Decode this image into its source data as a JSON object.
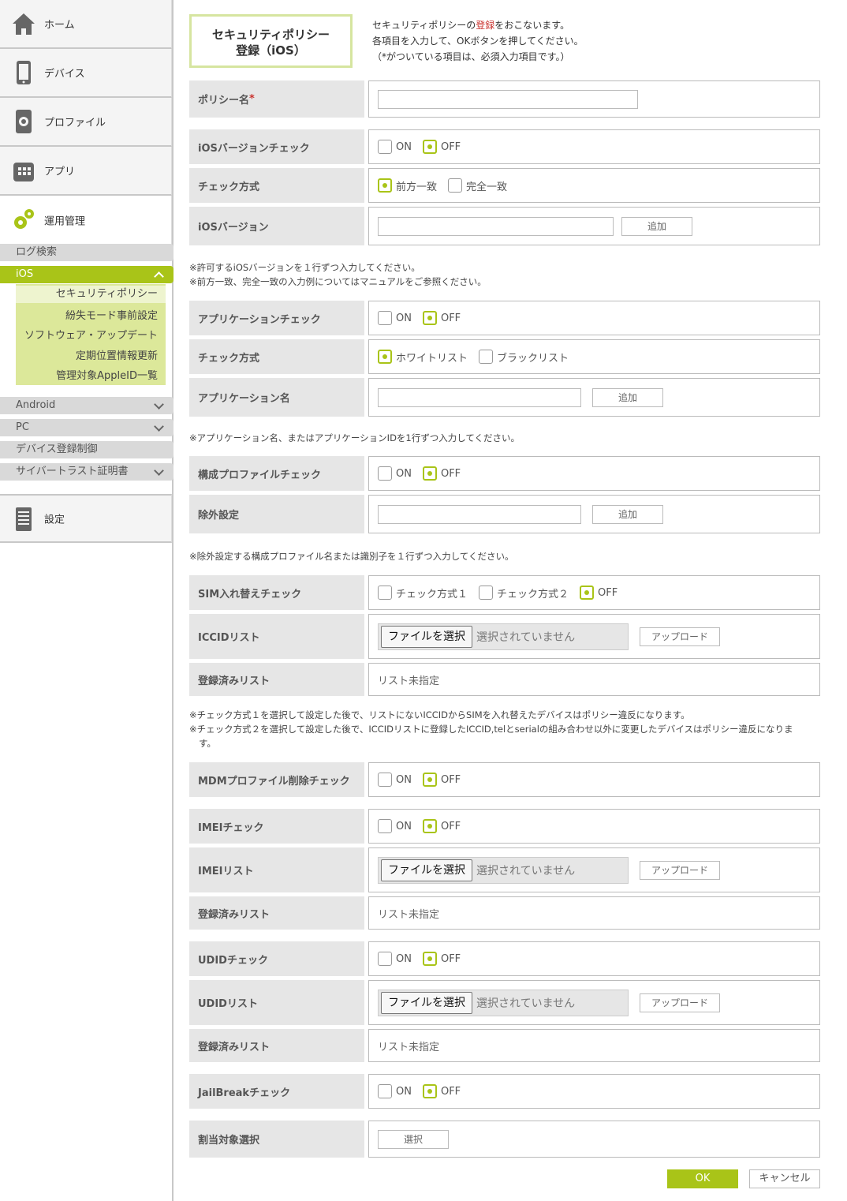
{
  "sidebar": {
    "nav": [
      {
        "label": "ホーム",
        "icon": "home-icon"
      },
      {
        "label": "デバイス",
        "icon": "phone-icon"
      },
      {
        "label": "プロファイル",
        "icon": "profile-gear-icon"
      },
      {
        "label": "アプリ",
        "icon": "app-icon"
      },
      {
        "label": "運用管理",
        "icon": "gears-icon"
      }
    ],
    "bars": {
      "log": "ログ検索",
      "ios": "iOS",
      "android": "Android",
      "pc": "PC",
      "device_reg": "デバイス登録制御",
      "cert": "サイバートラスト証明書"
    },
    "ios_sub": [
      "セキュリティポリシー",
      "紛失モード事前設定",
      "ソフトウェア・アップデート",
      "定期位置情報更新",
      "管理対象AppleID一覧"
    ],
    "settings": {
      "label": "設定",
      "icon": "document-icon"
    }
  },
  "header": {
    "title_line1": "セキュリティポリシー",
    "title_line2": "登録（iOS）",
    "intro_1a": "セキュリティポリシーの",
    "intro_1b": "登録",
    "intro_1c": "をおこないます。",
    "intro_2": "各項目を入力して、OKボタンを押してください。",
    "intro_3": "（*がついている項目は、必須入力項目です。）"
  },
  "form": {
    "policy_name": "ポリシー名",
    "required_mark": "*",
    "ios_version_check": "iOSバージョンチェック",
    "check_method": "チェック方式",
    "prefix_match": "前方一致",
    "exact_match": "完全一致",
    "ios_version": "iOSバージョン",
    "add": "追加",
    "note_ios_1": "※許可するiOSバージョンを１行ずつ入力してください。",
    "note_ios_2": "※前方一致、完全一致の入力例についてはマニュアルをご参照ください。",
    "app_check": "アプリケーションチェック",
    "whitelist": "ホワイトリスト",
    "blacklist": "ブラックリスト",
    "app_name": "アプリケーション名",
    "note_app": "※アプリケーション名、またはアプリケーションIDを1行ずつ入力してください。",
    "config_profile_check": "構成プロファイルチェック",
    "exclusion": "除外設定",
    "note_exclusion": "※除外設定する構成プロファイル名または識別子を１行ずつ入力してください。",
    "sim_check": "SIM入れ替えチェック",
    "method1": "チェック方式１",
    "method2": "チェック方式２",
    "iccid_list": "ICCIDリスト",
    "registered_list": "登録済みリスト",
    "not_specified": "リスト未指定",
    "choose_file": "ファイルを選択",
    "no_file": "選択されていません",
    "upload": "アップロード",
    "note_sim_1": "※チェック方式１を選択して設定した後で、リストにないICCIDからSIMを入れ替えたデバイスはポリシー違反になります。",
    "note_sim_2": "※チェック方式２を選択して設定した後で、ICCIDリストに登録したICCID,telとserialの組み合わせ以外に変更したデバイスはポリシー違反になりま",
    "note_sim_3": "す。",
    "mdm_check": "MDMプロファイル削除チェック",
    "imei_check": "IMEIチェック",
    "imei_list": "IMEIリスト",
    "udid_check": "UDIDチェック",
    "udid_list": "UDIDリスト",
    "jailbreak_check": "JailBreakチェック",
    "assign": "割当対象選択",
    "select": "選択",
    "on": "ON",
    "off": "OFF"
  },
  "footer": {
    "ok": "OK",
    "cancel": "キャンセル"
  },
  "colors": {
    "accent": "#a9c418",
    "required": "#c9302c"
  }
}
